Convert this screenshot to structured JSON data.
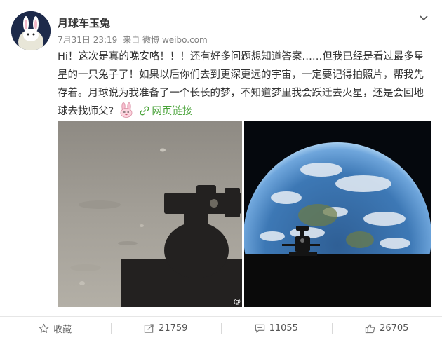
{
  "post": {
    "author_name": "月球车玉兔",
    "timestamp": "7月31日 23:19",
    "source_prefix": "来自",
    "source_name": "微博 weibo.com",
    "text_part1": "Hi！这次是真的晚安咯！！！还有好多问题想知道答案……但我已经是看过最多星星的一只兔子了！如果以后你们去到更深更远的宇宙，一定要记得拍照片，帮我先存着。月球说为我准备了一个长长的梦，不知道梦里我会跃迁去火星，还是会回地球去找师父?",
    "link_label": "网页链接",
    "photo_watermark": "@"
  },
  "actions": {
    "favorite_label": "收藏",
    "repost_count": "21759",
    "comment_count": "11055",
    "like_count": "26705"
  },
  "icons": {
    "more": "chevron-down-icon",
    "link": "link-icon",
    "favorite": "star-icon",
    "repost": "repost-icon",
    "comment": "comment-icon",
    "like": "thumbs-up-icon"
  },
  "colors": {
    "link": "#4aa33a",
    "text": "#333333",
    "meta": "#808080"
  }
}
